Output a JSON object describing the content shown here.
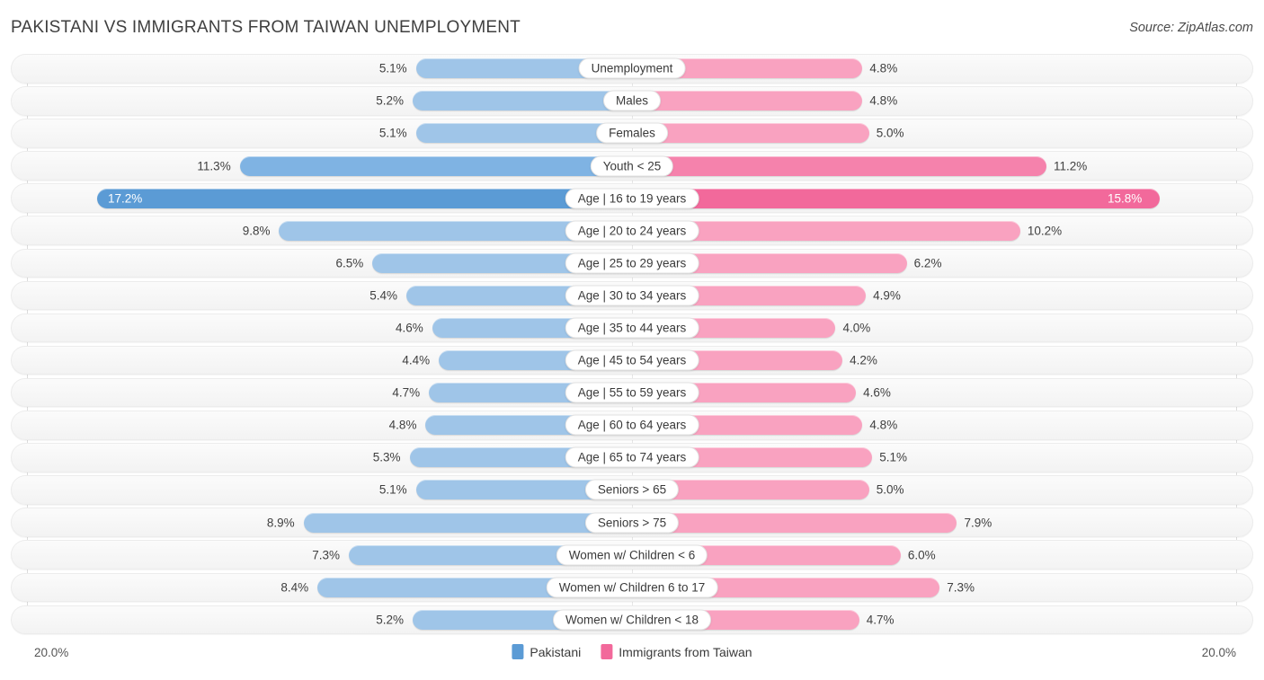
{
  "header": {
    "title": "PAKISTANI VS IMMIGRANTS FROM TAIWAN UNEMPLOYMENT",
    "source": "Source: ZipAtlas.com"
  },
  "legend": {
    "items": [
      {
        "label": "Pakistani",
        "color": "#5b9bd5"
      },
      {
        "label": "Immigrants from Taiwan",
        "color": "#f2699b"
      }
    ]
  },
  "axis": {
    "left_label": "20.0%",
    "right_label": "20.0%",
    "max": 20.0
  },
  "colors": {
    "blue_light": "#9fc5e8",
    "blue_mid": "#7fb3e3",
    "blue_strong": "#5b9bd5",
    "pink_light": "#f9a2c0",
    "pink_mid": "#f582ac",
    "pink_strong": "#f2699b",
    "row_background": "#f5f5f5",
    "text": "#3c3c3c"
  },
  "chart_data": {
    "type": "bar",
    "title": "PAKISTANI VS IMMIGRANTS FROM TAIWAN UNEMPLOYMENT",
    "orientation": "horizontal-diverging",
    "xlabel": "",
    "ylabel": "",
    "xlim": [
      -20.0,
      20.0
    ],
    "grid": true,
    "legend_position": "bottom-center",
    "categories": [
      "Unemployment",
      "Males",
      "Females",
      "Youth < 25",
      "Age | 16 to 19 years",
      "Age | 20 to 24 years",
      "Age | 25 to 29 years",
      "Age | 30 to 34 years",
      "Age | 35 to 44 years",
      "Age | 45 to 54 years",
      "Age | 55 to 59 years",
      "Age | 60 to 64 years",
      "Age | 65 to 74 years",
      "Seniors > 65",
      "Seniors > 75",
      "Women w/ Children < 6",
      "Women w/ Children 6 to 17",
      "Women w/ Children < 18"
    ],
    "series": [
      {
        "name": "Pakistani",
        "values": [
          5.1,
          5.2,
          5.1,
          11.3,
          17.2,
          9.8,
          6.5,
          5.4,
          4.6,
          4.4,
          4.7,
          4.8,
          5.3,
          5.1,
          8.9,
          7.3,
          8.4,
          5.2
        ],
        "labels": [
          "5.1%",
          "5.2%",
          "5.1%",
          "11.3%",
          "17.2%",
          "9.8%",
          "6.5%",
          "5.4%",
          "4.6%",
          "4.4%",
          "4.7%",
          "4.8%",
          "5.3%",
          "5.1%",
          "8.9%",
          "7.3%",
          "8.4%",
          "5.2%"
        ]
      },
      {
        "name": "Immigrants from Taiwan",
        "values": [
          4.8,
          4.8,
          5.0,
          11.2,
          15.8,
          10.2,
          6.2,
          4.9,
          4.0,
          4.2,
          4.6,
          4.8,
          5.1,
          5.0,
          7.9,
          6.0,
          7.3,
          4.7
        ],
        "labels": [
          "4.8%",
          "4.8%",
          "5.0%",
          "11.2%",
          "15.8%",
          "10.2%",
          "6.2%",
          "4.9%",
          "4.0%",
          "4.2%",
          "4.6%",
          "4.8%",
          "5.1%",
          "5.0%",
          "7.9%",
          "6.0%",
          "7.3%",
          "4.7%"
        ]
      }
    ]
  }
}
